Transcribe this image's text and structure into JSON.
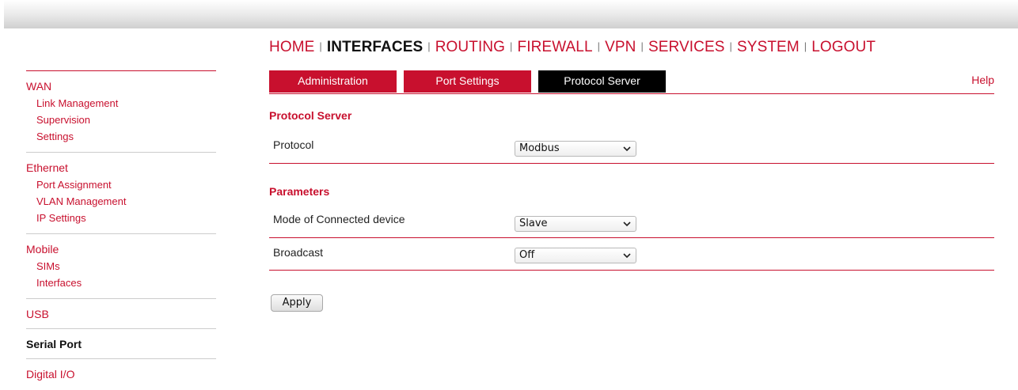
{
  "main_nav": [
    {
      "label": "HOME",
      "active": false
    },
    {
      "label": "INTERFACES",
      "active": true
    },
    {
      "label": "ROUTING",
      "active": false
    },
    {
      "label": "FIREWALL",
      "active": false
    },
    {
      "label": "VPN",
      "active": false
    },
    {
      "label": "SERVICES",
      "active": false
    },
    {
      "label": "SYSTEM",
      "active": false
    },
    {
      "label": "LOGOUT",
      "active": false
    }
  ],
  "nav_separator": "|",
  "sidebar": {
    "wan": {
      "title": "WAN",
      "items": [
        "Link Management",
        "Supervision",
        "Settings"
      ]
    },
    "ethernet": {
      "title": "Ethernet",
      "items": [
        "Port Assignment",
        "VLAN Management",
        "IP Settings"
      ]
    },
    "mobile": {
      "title": "Mobile",
      "items": [
        "SIMs",
        "Interfaces"
      ]
    },
    "usb": {
      "title": "USB"
    },
    "serial_port": {
      "title": "Serial Port",
      "active": true
    },
    "digital_io": {
      "title": "Digital I/O"
    }
  },
  "tabs": [
    {
      "label": "Administration",
      "active": false
    },
    {
      "label": "Port Settings",
      "active": false
    },
    {
      "label": "Protocol Server",
      "active": true
    }
  ],
  "help_label": "Help",
  "protocol_server": {
    "title": "Protocol Server",
    "protocol": {
      "label": "Protocol",
      "value": "Modbus"
    }
  },
  "parameters": {
    "title": "Parameters",
    "mode": {
      "label": "Mode of Connected device",
      "value": "Slave"
    },
    "broadcast": {
      "label": "Broadcast",
      "value": "Off"
    }
  },
  "apply_label": "Apply",
  "colors": {
    "accent": "#c8102e",
    "active_tab": "#000000",
    "text": "#222222"
  },
  "icons": {
    "dropdown": "chevron-down-icon"
  }
}
